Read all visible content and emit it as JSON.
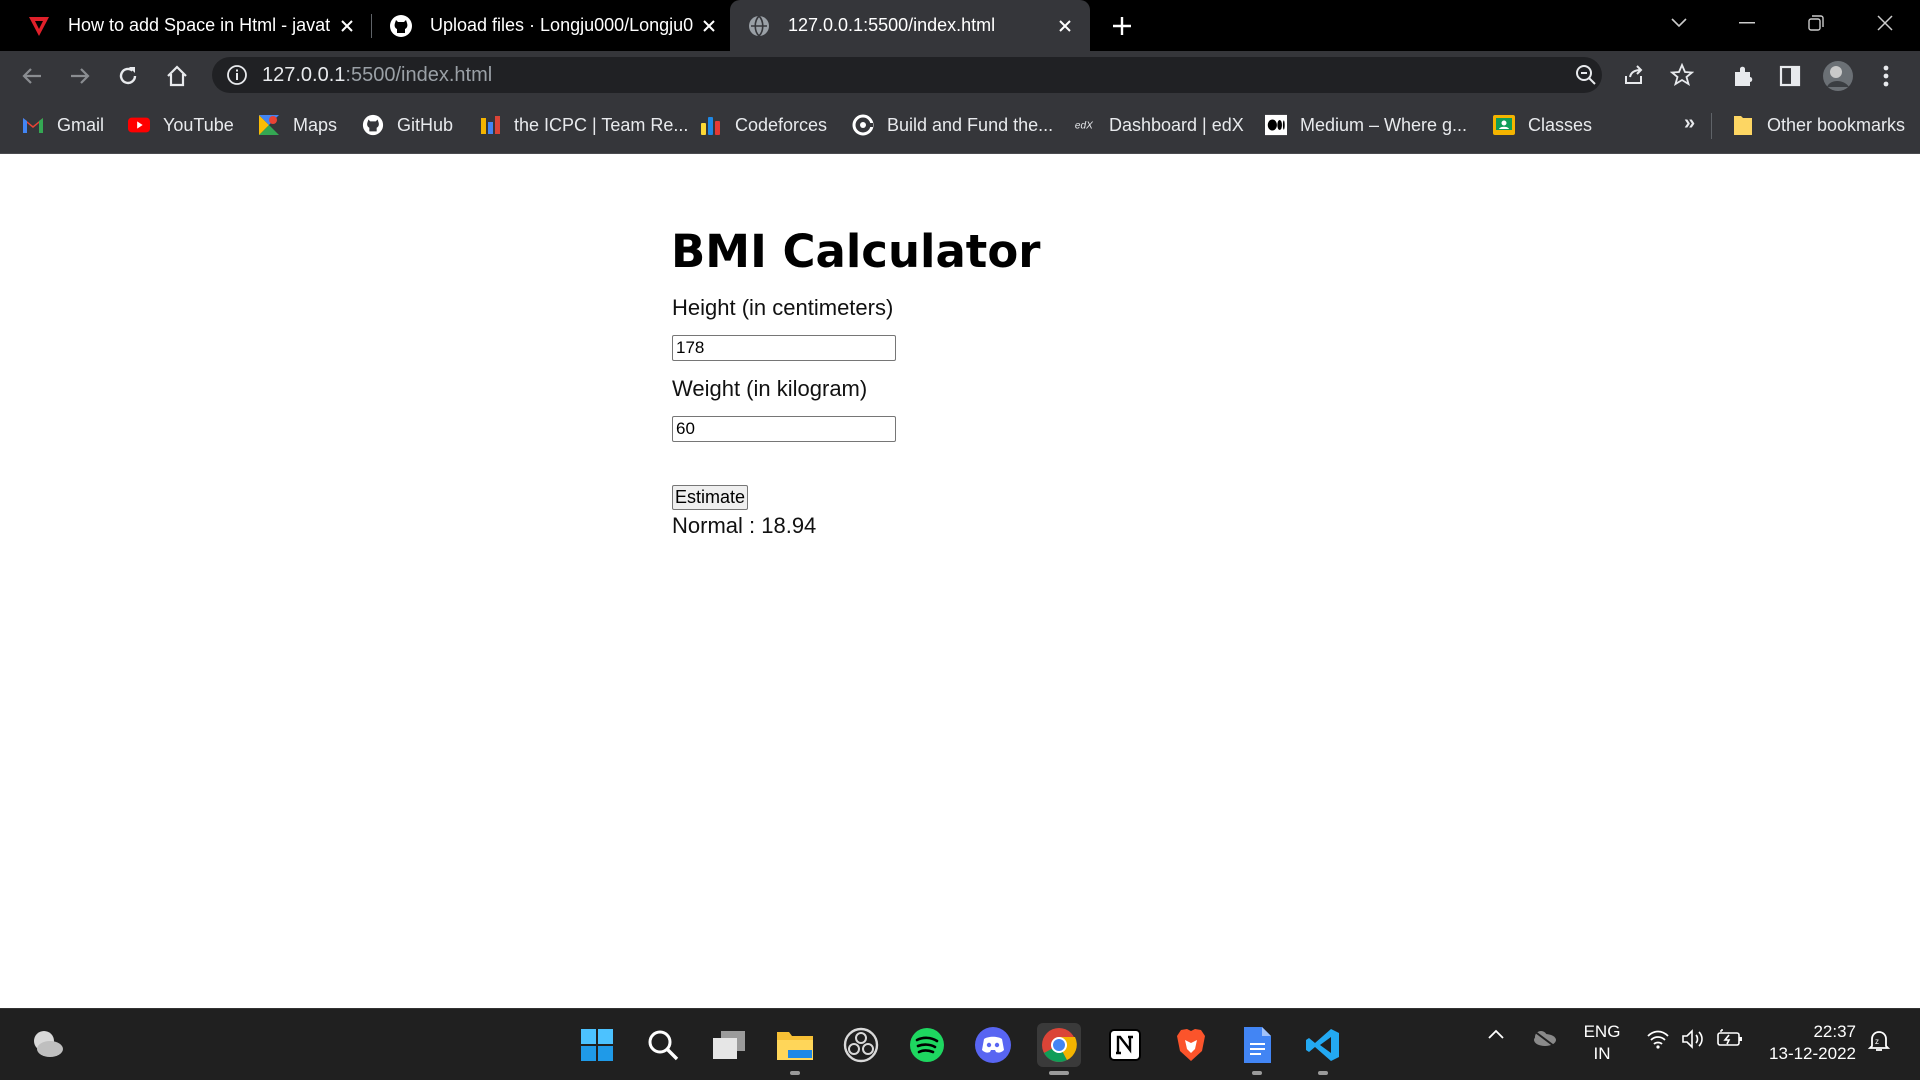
{
  "tabs": [
    {
      "title": "How to add Space in Html - javat",
      "icon": "javatpoint-icon",
      "active": false
    },
    {
      "title": "Upload files · Longju000/Longju0",
      "icon": "github-icon",
      "active": false
    },
    {
      "title": "127.0.0.1:5500/index.html",
      "icon": "globe-icon",
      "active": true
    }
  ],
  "address_bar": {
    "host": "127.0.0.1",
    "rest": ":5500/index.html"
  },
  "bookmarks": [
    {
      "label": "Gmail",
      "icon": "gmail-icon"
    },
    {
      "label": "YouTube",
      "icon": "youtube-icon"
    },
    {
      "label": "Maps",
      "icon": "maps-icon"
    },
    {
      "label": "GitHub",
      "icon": "github-icon"
    },
    {
      "label": "the ICPC | Team Re...",
      "icon": "icpc-icon"
    },
    {
      "label": "Codeforces",
      "icon": "codeforces-icon"
    },
    {
      "label": "Build and Fund the...",
      "icon": "gitcoin-icon"
    },
    {
      "label": "Dashboard | edX",
      "icon": "edx-icon"
    },
    {
      "label": "Medium – Where g...",
      "icon": "medium-icon"
    },
    {
      "label": "Classes",
      "icon": "classroom-icon"
    }
  ],
  "bookmarks_overflow": "»",
  "other_bookmarks": "Other bookmarks",
  "page": {
    "heading": "BMI Calculator",
    "height_label": "Height (in centimeters)",
    "height_value": "178",
    "weight_label": "Weight (in kilogram)",
    "weight_value": "60",
    "button_label": "Estimate",
    "result": "Normal : 18.94"
  },
  "taskbar": {
    "lang_top": "ENG",
    "lang_bottom": "IN",
    "time": "22:37",
    "date": "13-12-2022"
  },
  "colors": {
    "tab_active": "#35363a",
    "toolbar": "#35363a",
    "taskbar": "#202020"
  }
}
